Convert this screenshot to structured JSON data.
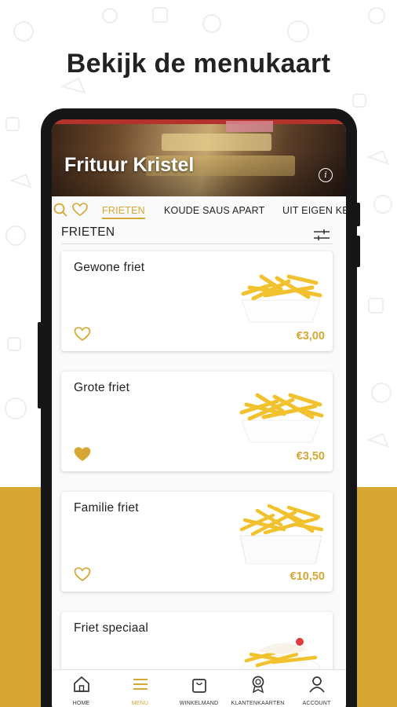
{
  "headline": "Bekijk de menukaart",
  "colors": {
    "accent": "#d6a733",
    "text": "#222222",
    "phone": "#161616"
  },
  "restaurant": {
    "name": "Frituur Kristel",
    "info_icon": "info-icon"
  },
  "search_icon": "search-icon",
  "favorites_icon": "heart-icon",
  "tabs": [
    {
      "label": "FRIETEN",
      "active": true
    },
    {
      "label": "KOUDE SAUS APART",
      "active": false
    },
    {
      "label": "UIT EIGEN KE",
      "active": false
    }
  ],
  "section": {
    "title": "FRIETEN",
    "filter_icon": "sliders-icon"
  },
  "products": [
    {
      "name": "Gewone friet",
      "price": "€3,00",
      "favorite": false
    },
    {
      "name": "Grote friet",
      "price": "€3,50",
      "favorite": true
    },
    {
      "name": "Familie friet",
      "price": "€10,50",
      "favorite": false
    },
    {
      "name": "Friet speciaal",
      "price": "",
      "favorite": false
    }
  ],
  "bottom_nav": [
    {
      "label": "HOME",
      "icon": "home-icon",
      "active": false
    },
    {
      "label": "MENU",
      "icon": "menu-icon",
      "active": true
    },
    {
      "label": "WINKELMAND",
      "icon": "shopping-bag-icon",
      "active": false
    },
    {
      "label": "KLANTENKAARTEN",
      "icon": "award-icon",
      "active": false
    },
    {
      "label": "ACCOUNT",
      "icon": "user-icon",
      "active": false
    }
  ]
}
